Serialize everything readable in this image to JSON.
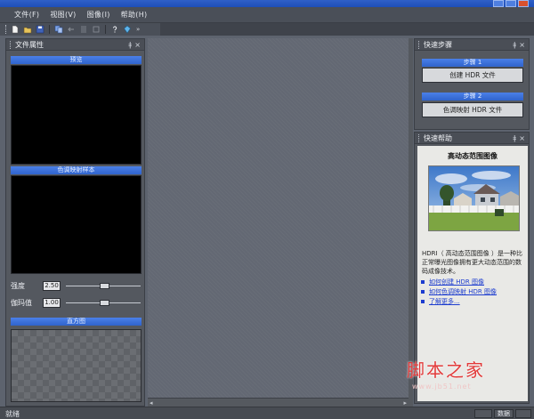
{
  "menubar": {
    "items": [
      "文件(F)",
      "视图(V)",
      "图像(I)",
      "帮助(H)"
    ]
  },
  "toolbar": {
    "icons": [
      "new-file-icon",
      "open-folder-icon",
      "save-icon",
      "copy-icon",
      "back-arrow-icon",
      "list-icon",
      "stack-icon",
      "help-question-icon",
      "gem-icon"
    ],
    "overflow": "»"
  },
  "left_panel": {
    "title": "文件属性",
    "pin": "ǂ",
    "close": "×",
    "preview_label": "预览",
    "tonemap_label": "色调映射样本",
    "params": [
      {
        "label": "强度",
        "value": "2.50",
        "level": 0.52
      },
      {
        "label": "伽玛值",
        "value": "1.00",
        "level": 0.52
      }
    ],
    "histogram_label": "直方图"
  },
  "quick_steps": {
    "title": "快速步骤",
    "pin": "ǂ",
    "close": "×",
    "step1_label": "步骤 1",
    "step1_button": "创建 HDR 文件",
    "step2_label": "步骤 2",
    "step2_button": "色调映射 HDR 文件"
  },
  "quick_help": {
    "title": "快速帮助",
    "pin": "ǂ",
    "close": "×",
    "heading": "高动态范围图像",
    "description": "HDRI（ 高动态范围图像 ）是一种比正常曝光图像拥有更大动态范围的数码成像技术。",
    "links": [
      "如何创建 HDR 图像",
      "如何色调映射 HDR 图像",
      "了解更多..."
    ]
  },
  "statusbar": {
    "text": "就绪",
    "cell": "数据"
  },
  "watermark": {
    "title": "脚本之家",
    "url": "www.jb51.net"
  },
  "colors": {
    "accent_bar": "#3a72dc",
    "panel": "#54585f",
    "link": "#1c3ccf",
    "watermark": "#e23a3a"
  }
}
